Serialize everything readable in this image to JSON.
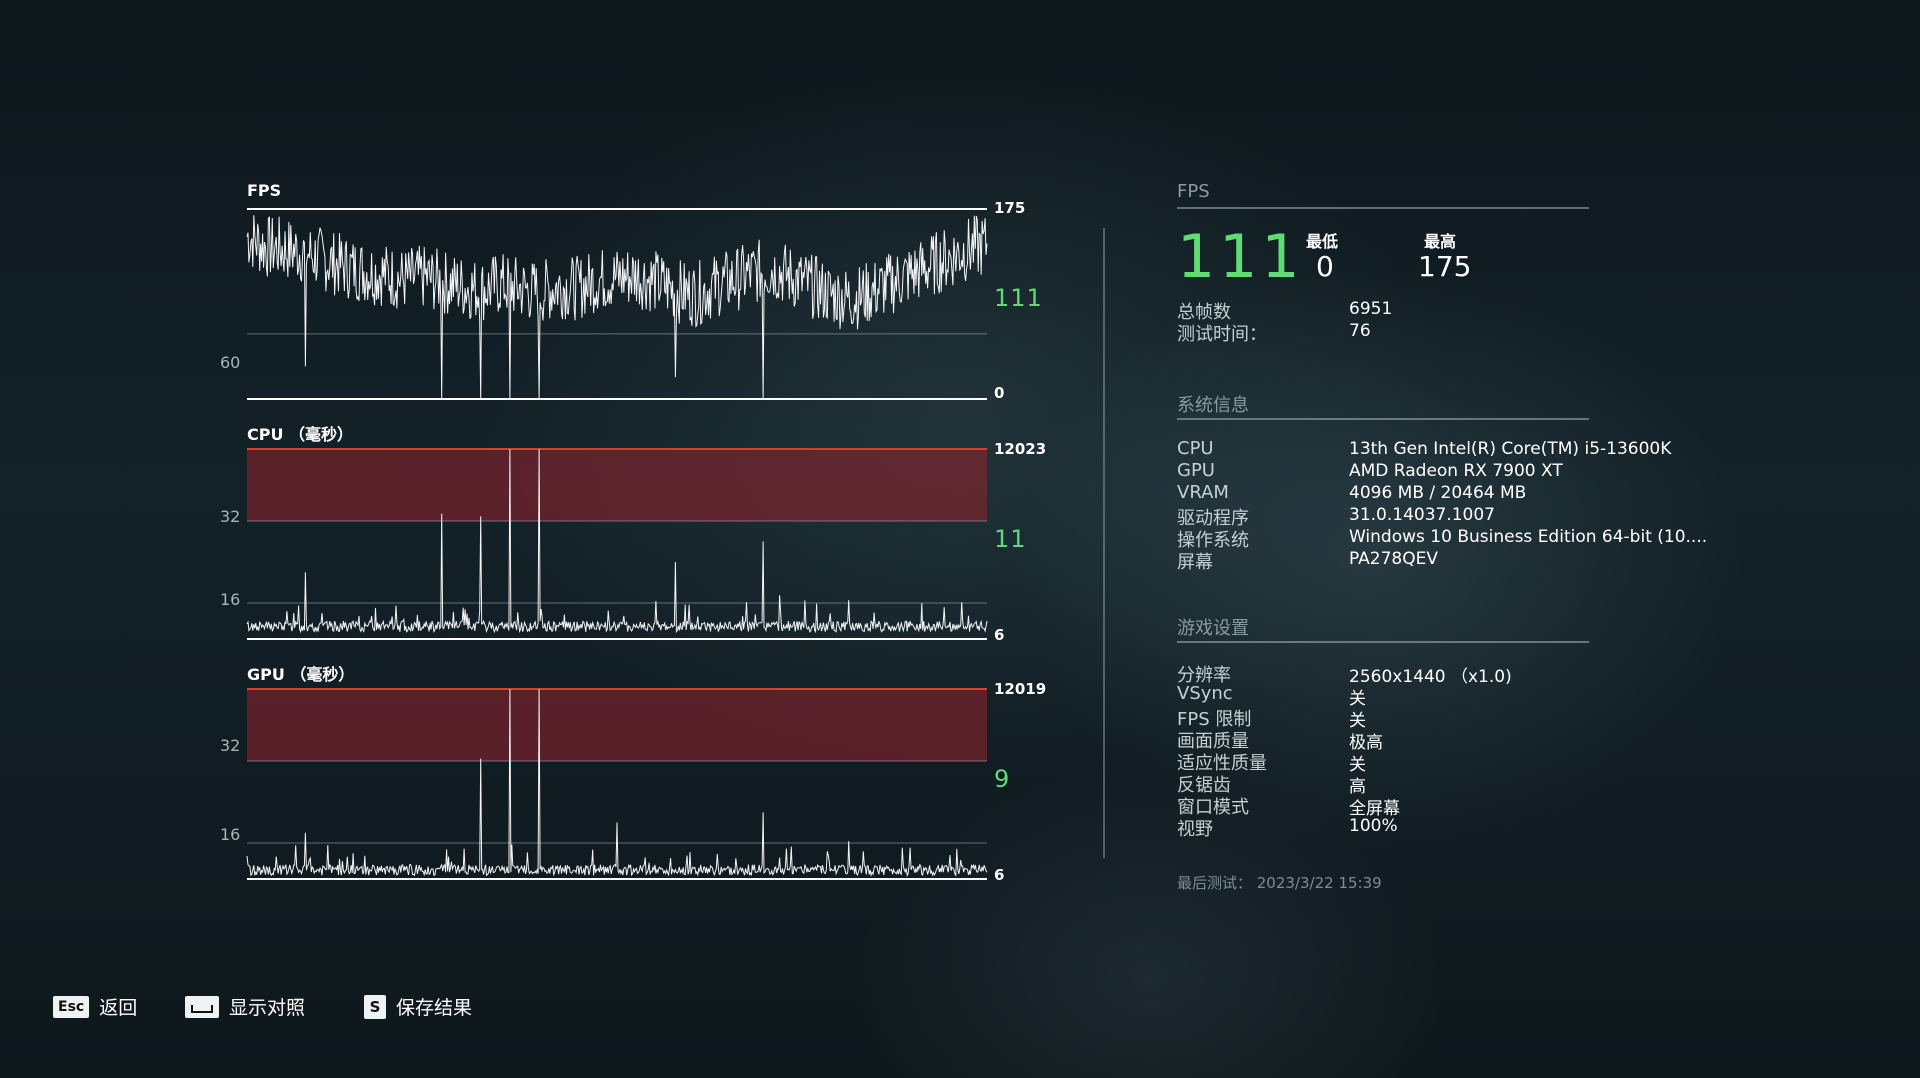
{
  "fps_panel": {
    "title": "FPS",
    "axis_top": "175",
    "axis_bottom": "0",
    "axis_ref": "60",
    "current": "111"
  },
  "cpu_panel": {
    "title": "CPU （毫秒）",
    "axis_top": "12023",
    "axis_bottom": "6",
    "axis_ref_high": "32",
    "axis_ref_low": "16",
    "current": "11"
  },
  "gpu_panel": {
    "title": "GPU （毫秒）",
    "axis_top": "12019",
    "axis_bottom": "6",
    "axis_ref_high": "32",
    "axis_ref_low": "16",
    "current": "9"
  },
  "summary": {
    "section_title": "FPS",
    "avg": "111",
    "min_label": "最低",
    "min_value": "0",
    "max_label": "最高",
    "max_value": "175",
    "total_frames_label": "总帧数",
    "total_frames_value": "6951",
    "test_time_label": "测试时间：",
    "test_time_value": "76"
  },
  "system_info": {
    "section_title": "系统信息",
    "rows": [
      {
        "key": "CPU",
        "value": "13th Gen Intel(R) Core(TM) i5-13600K"
      },
      {
        "key": "GPU",
        "value": "AMD Radeon RX 7900 XT"
      },
      {
        "key": "VRAM",
        "value": "4096 MB / 20464 MB"
      },
      {
        "key": "驱动程序",
        "value": "31.0.14037.1007"
      },
      {
        "key": "操作系统",
        "value": "Windows 10 Business Edition 64-bit (10...."
      },
      {
        "key": "屏幕",
        "value": "PA278QEV"
      }
    ]
  },
  "game_settings": {
    "section_title": "游戏设置",
    "rows": [
      {
        "key": "分辨率",
        "value": "2560x1440 （x1.0)"
      },
      {
        "key": "VSync",
        "value": "关"
      },
      {
        "key": "FPS 限制",
        "value": "关"
      },
      {
        "key": "画面质量",
        "value": "极高"
      },
      {
        "key": "适应性质量",
        "value": "关"
      },
      {
        "key": "反锯齿",
        "value": "高"
      },
      {
        "key": "窗口模式",
        "value": "全屏幕"
      },
      {
        "key": "视野",
        "value": "100%"
      }
    ]
  },
  "last_test": "最后测试： 2023/3/22 15:39",
  "footer": {
    "back_key": "Esc",
    "back_label": "返回",
    "compare_label": "显示对照",
    "save_key": "S",
    "save_label": "保存结果"
  },
  "colors": {
    "accent_green": "#5fdc74",
    "threshold_red": "#e03a30",
    "threshold_band": "rgba(140,35,45,0.6)"
  },
  "chart_data": [
    {
      "type": "line",
      "title": "FPS",
      "ylim": [
        0,
        175
      ],
      "reference_lines": [
        60
      ],
      "x": [
        0,
        2,
        4,
        6,
        8,
        10,
        12,
        14,
        16,
        18,
        20,
        22,
        24,
        26,
        28,
        30,
        32,
        34,
        36,
        38,
        40,
        42,
        44,
        46,
        48,
        50,
        52,
        54,
        56,
        58,
        60,
        62,
        64,
        66,
        68,
        70,
        72,
        74,
        76
      ],
      "series": [
        {
          "values": [
            150,
            140,
            138,
            135,
            128,
            122,
            118,
            115,
            110,
            112,
            108,
            104,
            100,
            106,
            102,
            98,
            104,
            102,
            110,
            112,
            114,
            108,
            100,
            96,
            104,
            110,
            116,
            120,
            112,
            104,
            96,
            92,
            98,
            106,
            114,
            122,
            130,
            138,
            142
          ]
        }
      ],
      "spikes": [
        {
          "x": 6,
          "value": 30
        },
        {
          "x": 20,
          "value": 0
        },
        {
          "x": 24,
          "value": 0
        },
        {
          "x": 27,
          "value": 0
        },
        {
          "x": 30,
          "value": 0
        },
        {
          "x": 44,
          "value": 20
        },
        {
          "x": 53,
          "value": 0
        }
      ]
    },
    {
      "type": "line",
      "title": "CPU （毫秒）",
      "ylabel": "毫秒",
      "y_ticks": [
        6,
        16,
        32,
        12023
      ],
      "baseline_ms": 8,
      "spikes": [
        {
          "x": 6,
          "value": 22
        },
        {
          "x": 20,
          "value": 38
        },
        {
          "x": 24,
          "value": 36
        },
        {
          "x": 27,
          "value": 12023
        },
        {
          "x": 30,
          "value": 12023
        },
        {
          "x": 44,
          "value": 24
        },
        {
          "x": 53,
          "value": 28
        }
      ],
      "current": 11
    },
    {
      "type": "line",
      "title": "GPU （毫秒）",
      "ylabel": "毫秒",
      "y_ticks": [
        6,
        16,
        32,
        12019
      ],
      "baseline_ms": 7,
      "spikes": [
        {
          "x": 6,
          "value": 18
        },
        {
          "x": 24,
          "value": 34
        },
        {
          "x": 27,
          "value": 12019
        },
        {
          "x": 30,
          "value": 12019
        },
        {
          "x": 38,
          "value": 20
        },
        {
          "x": 53,
          "value": 22
        }
      ],
      "current": 9
    }
  ]
}
